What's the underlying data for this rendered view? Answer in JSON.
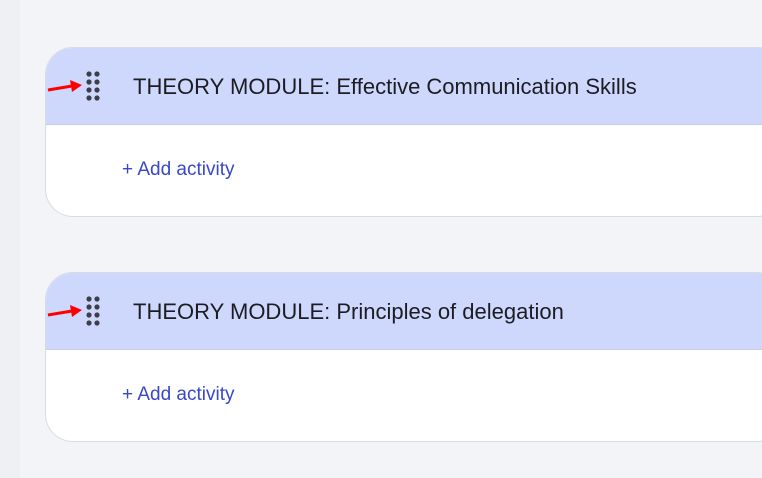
{
  "modules": [
    {
      "title": "THEORY MODULE: Effective Communication Skills",
      "add_activity_label": "+ Add activity"
    },
    {
      "title": "THEORY MODULE: Principles of delegation",
      "add_activity_label": "+ Add activity"
    }
  ],
  "colors": {
    "page_background": "#f3f4f8",
    "header_background": "#cdd8fc",
    "link": "#3a47c8",
    "annotation_arrow": "#ff0000"
  },
  "icons": {
    "drag_handle": "drag-handle-icon",
    "annotation": "red-arrow-icon"
  }
}
